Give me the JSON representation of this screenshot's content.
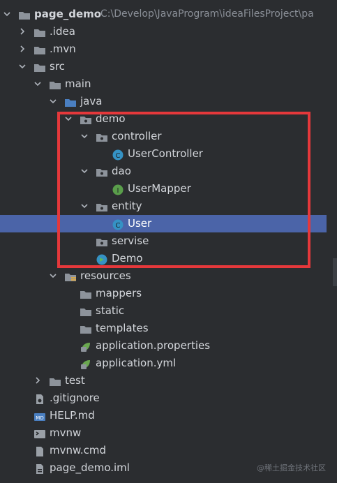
{
  "tree": {
    "root": {
      "label": "page_demo",
      "path": "C:\\Develop\\JavaProgram\\ideaFilesProject\\pa"
    },
    "idea": "idea",
    "idea_prefix": ".",
    "mvn": ".mvn",
    "src": "src",
    "main": "main",
    "java": "java",
    "demo": "demo",
    "controller": "controller",
    "user_controller": "UserController",
    "dao": "dao",
    "user_mapper": "UserMapper",
    "entity": "entity",
    "user": "User",
    "servise": "servise",
    "demo_app": "Demo",
    "resources": "resources",
    "mappers": "mappers",
    "static": "static",
    "templates": "templates",
    "app_props": "application.properties",
    "app_yml": "application.yml",
    "test": "test",
    "gitignore": ".gitignore",
    "help": "HELP.md",
    "mvnw": "mvnw",
    "mvnw_cmd": "mvnw.cmd",
    "iml": "page_demo.iml"
  },
  "watermark": "@稀土掘金技术社区",
  "colors": {
    "background": "#2b2d30",
    "selection": "#4b64a8",
    "highlight_box": "#e5383b",
    "class_icon": "#3592c4",
    "interface_icon": "#5a9e4b",
    "folder": "#8d939b"
  }
}
